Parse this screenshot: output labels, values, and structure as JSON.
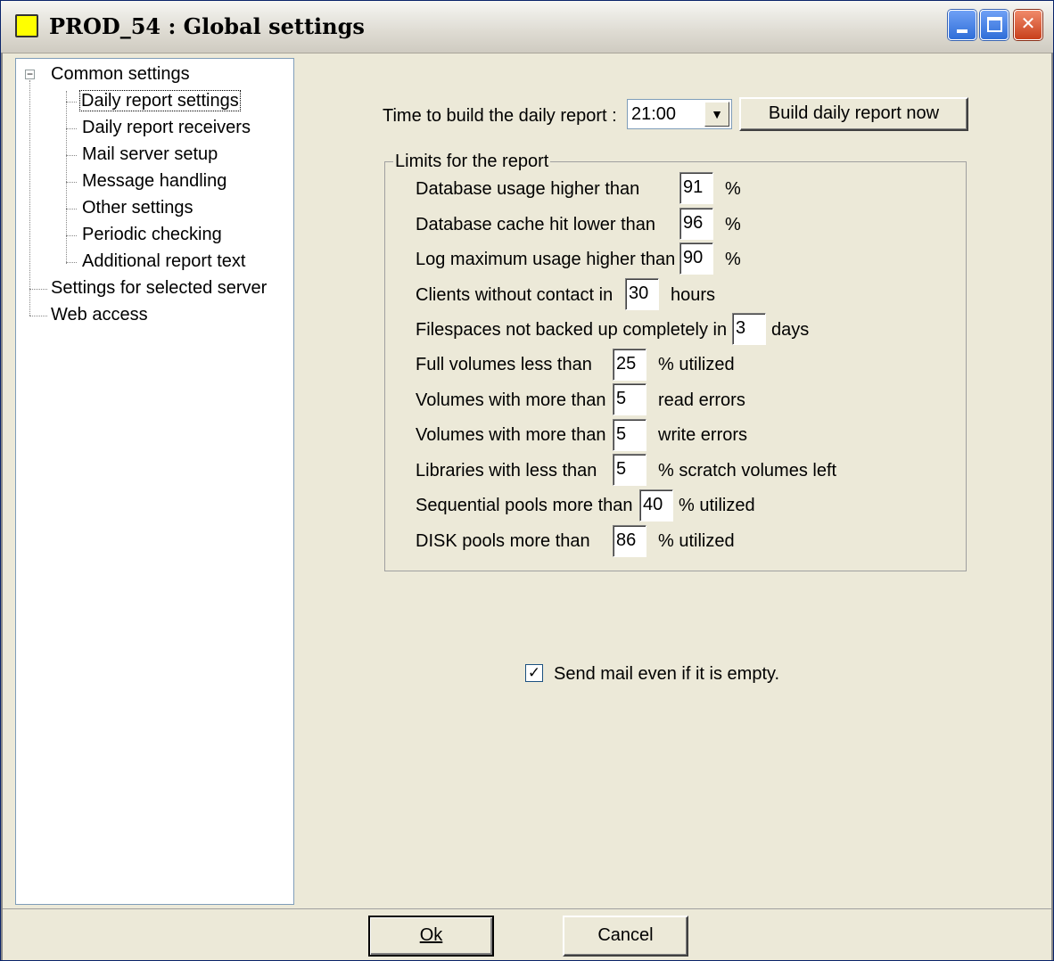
{
  "window": {
    "title": "PROD_54 : Global settings",
    "icon": "yellow-square-icon"
  },
  "tree": {
    "root": "Common settings",
    "children": [
      "Daily report settings",
      "Daily report receivers",
      "Mail server setup",
      "Message handling",
      "Other settings",
      "Periodic checking",
      "Additional report text"
    ],
    "selected": "Daily report settings",
    "others": [
      "Settings for selected server",
      "Web access"
    ]
  },
  "schedule": {
    "label": "Time to build the daily report :",
    "time_value": "21:00",
    "build_button": "Build daily report now"
  },
  "limits": {
    "title": "Limits for the report",
    "rows": [
      {
        "pre": "Database usage higher than",
        "value": "91",
        "post": "%"
      },
      {
        "pre": "Database cache hit lower than",
        "value": "96",
        "post": "%"
      },
      {
        "pre": "Log maximum usage higher than",
        "value": "90",
        "post": "%"
      },
      {
        "pre": "Clients without contact in",
        "value": "30",
        "post": "hours"
      },
      {
        "pre": "Filespaces not backed up completely in",
        "value": "3",
        "post": "days"
      },
      {
        "pre": "Full volumes less than",
        "value": "25",
        "post": "% utilized"
      },
      {
        "pre": "Volumes with more than",
        "value": "5",
        "post": "read errors"
      },
      {
        "pre": "Volumes with more than",
        "value": "5",
        "post": "write errors"
      },
      {
        "pre": "Libraries with less than",
        "value": "5",
        "post": "% scratch volumes left"
      },
      {
        "pre": "Sequential pools more than",
        "value": "40",
        "post": "% utilized"
      },
      {
        "pre": "DISK pools more than",
        "value": "86",
        "post": "% utilized"
      }
    ]
  },
  "send_mail": {
    "label": "Send mail even if it is empty.",
    "checked": true
  },
  "footer": {
    "ok": "Ok",
    "cancel": "Cancel"
  }
}
